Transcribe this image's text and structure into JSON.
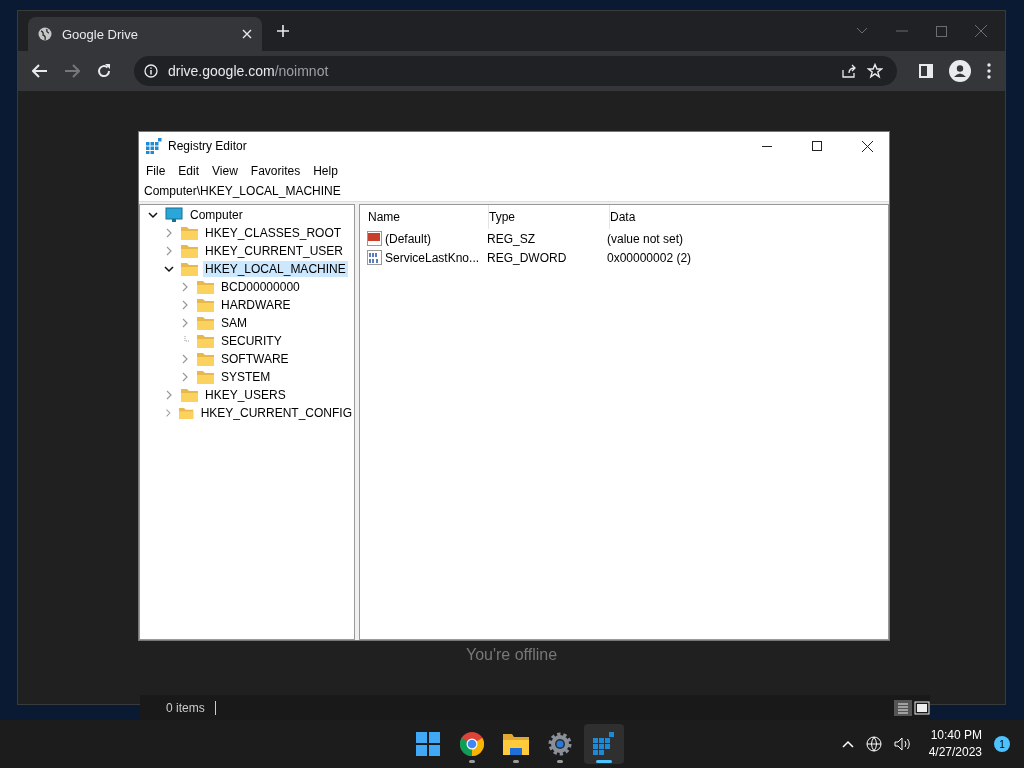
{
  "browser": {
    "tab": {
      "title": "Google Drive"
    },
    "url": {
      "host": "drive.google.com",
      "path": "/noimnot"
    },
    "content": {
      "message": "You're offline"
    }
  },
  "explorer_status": {
    "text": "0 items"
  },
  "regedit": {
    "title": "Registry Editor",
    "menu": [
      "File",
      "Edit",
      "View",
      "Favorites",
      "Help"
    ],
    "address": "Computer\\HKEY_LOCAL_MACHINE",
    "tree": [
      {
        "label": "Computer",
        "kind": "computer",
        "expandable": true,
        "expanded": true,
        "selected": false,
        "children": [
          {
            "label": "HKEY_CLASSES_ROOT",
            "kind": "folder",
            "expandable": true,
            "expanded": false,
            "selected": false
          },
          {
            "label": "HKEY_CURRENT_USER",
            "kind": "folder",
            "expandable": true,
            "expanded": false,
            "selected": false
          },
          {
            "label": "HKEY_LOCAL_MACHINE",
            "kind": "folder",
            "expandable": true,
            "expanded": true,
            "selected": true,
            "children": [
              {
                "label": "BCD00000000",
                "kind": "folder",
                "expandable": true,
                "expanded": false,
                "selected": false
              },
              {
                "label": "HARDWARE",
                "kind": "folder",
                "expandable": true,
                "expanded": false,
                "selected": false
              },
              {
                "label": "SAM",
                "kind": "folder",
                "expandable": true,
                "expanded": false,
                "selected": false
              },
              {
                "label": "SECURITY",
                "kind": "folder",
                "expandable": false,
                "selected": false
              },
              {
                "label": "SOFTWARE",
                "kind": "folder",
                "expandable": true,
                "expanded": false,
                "selected": false
              },
              {
                "label": "SYSTEM",
                "kind": "folder",
                "expandable": true,
                "expanded": false,
                "selected": false
              }
            ]
          },
          {
            "label": "HKEY_USERS",
            "kind": "folder",
            "expandable": true,
            "expanded": false,
            "selected": false
          },
          {
            "label": "HKEY_CURRENT_CONFIG",
            "kind": "folder",
            "expandable": true,
            "expanded": false,
            "selected": false
          }
        ]
      }
    ],
    "columns": [
      "Name",
      "Type",
      "Data"
    ],
    "values": [
      {
        "kind": "string",
        "name": "(Default)",
        "type": "REG_SZ",
        "data": "(value not set)"
      },
      {
        "kind": "binary",
        "name": "ServiceLastKno...",
        "type": "REG_DWORD",
        "data": "0x00000002 (2)"
      }
    ]
  },
  "taskbar": {
    "apps": [
      {
        "kind": "start",
        "running": false,
        "selected": false
      },
      {
        "kind": "chrome",
        "running": true,
        "selected": false
      },
      {
        "kind": "folder",
        "running": true,
        "selected": false
      },
      {
        "kind": "settings",
        "running": true,
        "selected": false
      },
      {
        "kind": "regedit",
        "running": true,
        "selected": true
      }
    ],
    "time": "10:40 PM",
    "date": "4/27/2023",
    "notifications": "1"
  }
}
